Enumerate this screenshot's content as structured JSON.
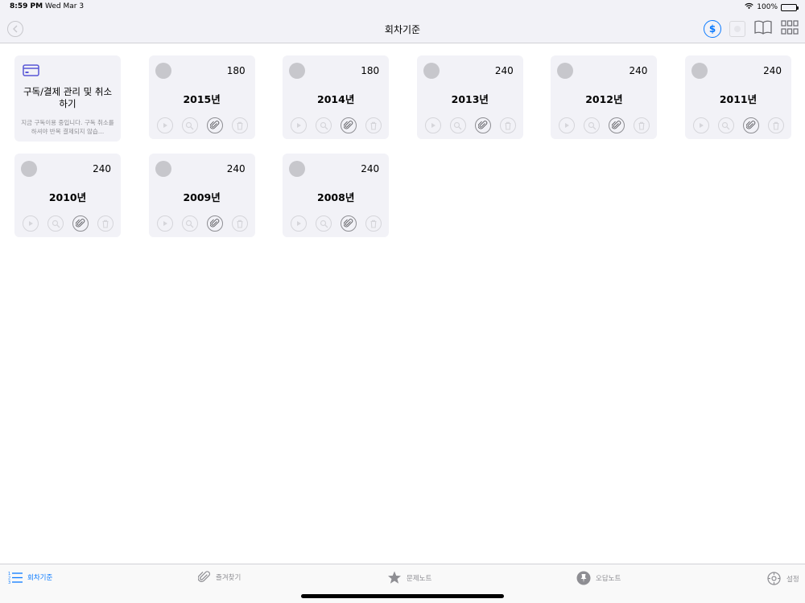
{
  "status": {
    "time": "8:59 PM",
    "date": "Wed Mar 3",
    "battery": "100%"
  },
  "nav": {
    "title": "회차기준",
    "back_icon": "chevron-left-icon",
    "actions": [
      "dollar-icon",
      "record-icon",
      "book-icon",
      "grid-icon"
    ],
    "accent": "#0a7aff"
  },
  "subscription_card": {
    "icon": "credit-card-icon",
    "title": "구독/결제 관리 및 취소하기",
    "description": "지금 구독이용 중입니다. 구독 취소를 하셔야 반복 결제되지 않습…"
  },
  "years": [
    {
      "count": "180",
      "label": "2015년"
    },
    {
      "count": "180",
      "label": "2014년"
    },
    {
      "count": "240",
      "label": "2013년"
    },
    {
      "count": "240",
      "label": "2012년"
    },
    {
      "count": "240",
      "label": "2011년"
    },
    {
      "count": "240",
      "label": "2010년"
    },
    {
      "count": "240",
      "label": "2009년"
    },
    {
      "count": "240",
      "label": "2008년"
    }
  ],
  "card_actions": [
    "play-icon",
    "search-icon",
    "paperclip-icon",
    "trash-icon"
  ],
  "tabs": [
    {
      "label": "회차기준",
      "icon": "list-numbered-icon",
      "active": true
    },
    {
      "label": "즐겨찾기",
      "icon": "paperclip-icon",
      "active": false
    },
    {
      "label": "문제노트",
      "icon": "star-icon",
      "active": false
    },
    {
      "label": "오답노트",
      "icon": "pin-icon",
      "active": false
    },
    {
      "label": "설정",
      "icon": "gear-icon",
      "active": false
    }
  ]
}
